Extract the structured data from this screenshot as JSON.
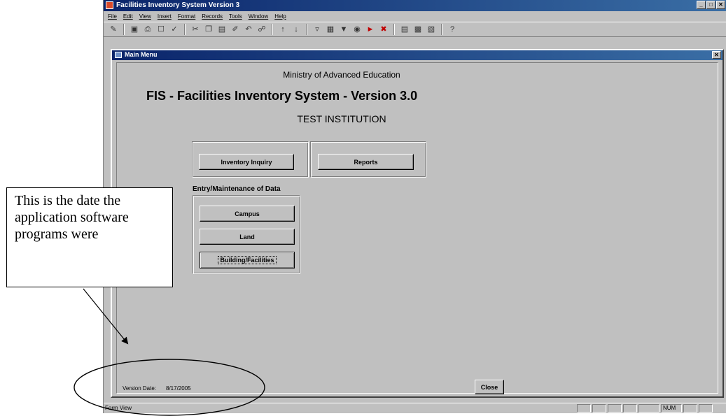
{
  "app": {
    "title": "Facilities Inventory System Version 3",
    "window_buttons": [
      "_",
      "□",
      "✕"
    ]
  },
  "menu": [
    "File",
    "Edit",
    "View",
    "Insert",
    "Format",
    "Records",
    "Tools",
    "Window",
    "Help"
  ],
  "child_window": {
    "title": "Main Menu",
    "close": "✕"
  },
  "form": {
    "ministry": "Ministry of Advanced Education",
    "system_title": "FIS  - Facilities Inventory System - Version 3.0",
    "institution": "TEST INSTITUTION",
    "inquiry_button": "Inventory Inquiry",
    "reports_button": "Reports",
    "entry_label": "Entry/Maintenance of Data",
    "campus_button": "Campus",
    "land_button": "Land",
    "building_button": "Building/Facilities",
    "version_label": "Version Date:",
    "version_date": "8/17/2005",
    "close_button": "Close"
  },
  "status": {
    "mode": "Form View",
    "num": "NUM"
  },
  "callout": {
    "text": "This is the date the application software programs were"
  },
  "colors": {
    "titlebar": "#0a246a",
    "face": "#c0c0c0"
  }
}
